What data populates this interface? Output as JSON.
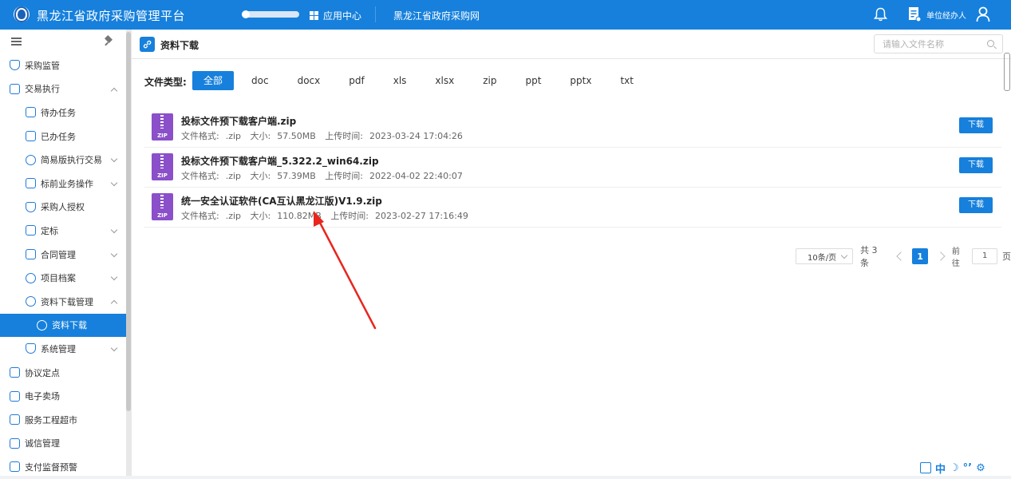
{
  "topbar": {
    "app_title": "黑龙江省政府采购管理平台",
    "app_center_label": "应用中心",
    "site_link": "黑龙江省政府采购网",
    "unit_label": "单位经办人",
    "icons": [
      "grid-icon",
      "bell-icon",
      "document-icon",
      "user-icon"
    ]
  },
  "sidebar": {
    "items": [
      {
        "label": "采购监管",
        "icon": "shield-icon"
      },
      {
        "label": "交易执行",
        "icon": "clipboard-icon",
        "expanded": true
      },
      {
        "label": "待办任务",
        "icon": "task-icon"
      },
      {
        "label": "已办任务",
        "icon": "task-done-icon"
      },
      {
        "label": "简易版执行交易",
        "icon": "simple-trade-icon"
      },
      {
        "label": "标前业务操作",
        "icon": "cart-icon"
      },
      {
        "label": "采购人授权",
        "icon": "authorize-icon"
      },
      {
        "label": "定标",
        "icon": "bid-icon"
      },
      {
        "label": "合同管理",
        "icon": "contract-icon"
      },
      {
        "label": "项目档案",
        "icon": "archive-icon"
      },
      {
        "label": "资料下载管理",
        "icon": "link-icon",
        "expanded": true
      },
      {
        "label": "资料下载",
        "icon": "link-icon",
        "active": true
      },
      {
        "label": "系统管理",
        "icon": "settings-shield-icon"
      },
      {
        "label": "协议定点",
        "icon": "store-icon"
      },
      {
        "label": "电子卖场",
        "icon": "store-icon"
      },
      {
        "label": "服务工程超市",
        "icon": "store-icon"
      },
      {
        "label": "诚信管理",
        "icon": "credit-icon"
      },
      {
        "label": "支付监督预警",
        "icon": "chart-icon"
      }
    ]
  },
  "main": {
    "page_title": "资料下载",
    "search_placeholder": "请输入文件名称",
    "type_label": "文件类型:",
    "types": [
      "全部",
      "doc",
      "docx",
      "pdf",
      "xls",
      "xlsx",
      "zip",
      "ppt",
      "pptx",
      "txt"
    ],
    "active_type": "全部",
    "files": [
      {
        "name": "投标文件预下载客户端.zip",
        "format_label": "文件格式:",
        "format": ".zip",
        "size_label": "大小:",
        "size": "57.50MB",
        "time_label": "上传时间:",
        "time": "2023-03-24 17:04:26",
        "download_label": "下载",
        "icon_text": "ZIP"
      },
      {
        "name": "投标文件预下载客户端_5.322.2_win64.zip",
        "format_label": "文件格式:",
        "format": ".zip",
        "size_label": "大小:",
        "size": "57.39MB",
        "time_label": "上传时间:",
        "time": "2022-04-02 22:40:07",
        "download_label": "下载",
        "icon_text": "ZIP"
      },
      {
        "name": "统一安全认证软件(CA互认黑龙江版)V1.9.zip",
        "format_label": "文件格式:",
        "format": ".zip",
        "size_label": "大小:",
        "size": "110.82MB",
        "time_label": "上传时间:",
        "time": "2023-02-27 17:16:49",
        "download_label": "下载",
        "icon_text": "ZIP"
      }
    ],
    "pagination": {
      "page_size": "10条/页",
      "total": "共 3 条",
      "current_page": "1",
      "goto_label": "前往",
      "goto_value": "1",
      "page_unit": "页"
    }
  },
  "toolbar": {
    "lang_label": "中",
    "symbols": [
      "☽",
      "°’",
      "⚙"
    ]
  },
  "colors": {
    "primary": "#1680dc",
    "zip_icon": "#8a4fc9",
    "annotation_arrow": "#e8251f"
  }
}
